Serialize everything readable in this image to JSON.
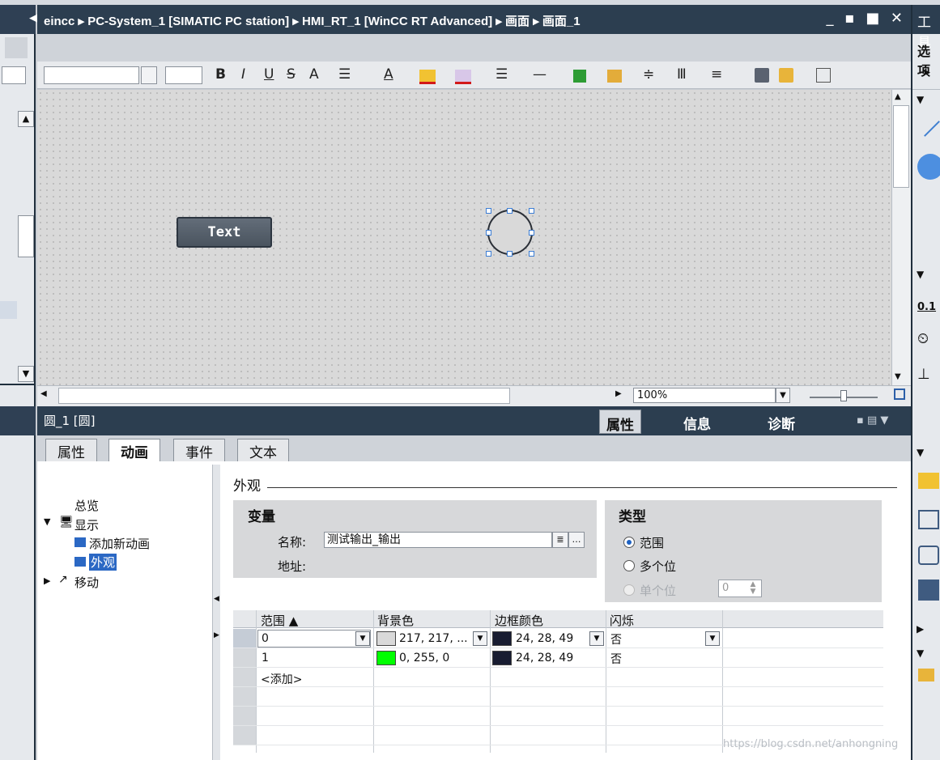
{
  "title_bar": {
    "breadcrumb": "eincc ▸ PC-System_1 [SIMATIC PC station] ▸ HMI_RT_1 [WinCC RT Advanced] ▸ 画面 ▸ 画面_1",
    "controls": "_ ▪ ■ ✕"
  },
  "toolbar": {
    "bold": "B",
    "italic": "I",
    "underline": "U",
    "strike": "S"
  },
  "canvas": {
    "button_text": "Text"
  },
  "zoom": {
    "value": "100%"
  },
  "properties": {
    "object_title": "圆_1 [圆]",
    "tabs": [
      "属性",
      "信息",
      "诊断"
    ],
    "subtabs": [
      "属性",
      "动画",
      "事件",
      "文本"
    ]
  },
  "tree": {
    "items": [
      "总览",
      "显示",
      "添加新动画",
      "外观",
      "移动"
    ]
  },
  "appearance": {
    "section_title": "外观",
    "variable_group": "变量",
    "name_label": "名称:",
    "tag_name": "测试输出_输出",
    "address_label": "地址:",
    "type_group": "类型",
    "type_options": [
      "范围",
      "多个位",
      "单个位"
    ],
    "bit_value": "0"
  },
  "grid": {
    "headers": [
      "范围 ▲",
      "背景色",
      "边框颜色",
      "闪烁"
    ],
    "rows": [
      {
        "range": "0",
        "bg_color": "217, 217, ...",
        "bg_hex": "#d9d9d9",
        "border_color": "24, 28, 49",
        "border_hex": "#181c31",
        "blink": "否"
      },
      {
        "range": "1",
        "bg_color": "0, 255, 0",
        "bg_hex": "#00ff00",
        "border_color": "24, 28, 49",
        "border_hex": "#181c31",
        "blink": "否"
      }
    ],
    "add_row": "<添加>"
  },
  "right_panel": {
    "title": "工具",
    "label_options": "选项"
  },
  "watermark": "https://blog.csdn.net/anhongning"
}
